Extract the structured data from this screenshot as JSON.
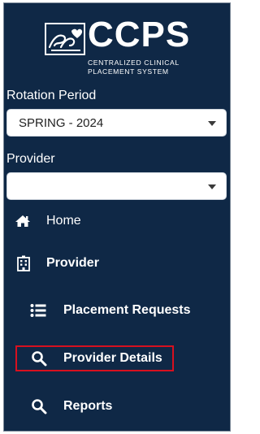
{
  "logo": {
    "title": "CCPS",
    "subtitle_line1": "CENTRALIZED CLINICAL",
    "subtitle_line2": "PLACEMENT SYSTEM",
    "emblem_icon": "hands-heart-emblem"
  },
  "rotation_period": {
    "label": "Rotation Period",
    "selected": "SPRING - 2024"
  },
  "provider_select": {
    "label": "Provider",
    "selected": ""
  },
  "nav": {
    "home": {
      "label": "Home",
      "icon": "home-icon"
    },
    "provider": {
      "label": "Provider",
      "icon": "building-icon"
    },
    "placement_requests": {
      "label": "Placement Requests",
      "icon": "list-icon"
    },
    "provider_details": {
      "label": "Provider Details",
      "icon": "search-icon",
      "highlighted": true
    },
    "reports": {
      "label": "Reports",
      "icon": "search-icon"
    }
  },
  "colors": {
    "sidebar_bg": "#0f2846",
    "text": "#ffffff",
    "highlight_border": "#d7101f"
  }
}
